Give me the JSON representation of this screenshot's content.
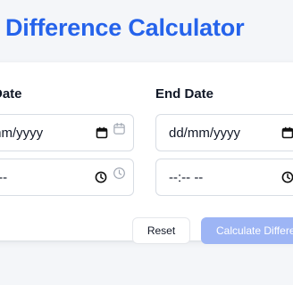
{
  "title": "Difference Calculator",
  "start": {
    "label": "Date",
    "date_value": "mm/yyyy",
    "time_value": "- --"
  },
  "end": {
    "label": "End Date",
    "date_value": "dd/mm/yyyy",
    "time_value": "--:-- --"
  },
  "actions": {
    "reset_label": "Reset",
    "calculate_label": "Calculate Differen"
  },
  "icons": {
    "date_picker": "calendar-icon",
    "time_picker": "clock-icon"
  },
  "colors": {
    "accent": "#2563eb",
    "calculate_disabled": "#9db5f5",
    "muted_icon": "#9ca3af"
  }
}
